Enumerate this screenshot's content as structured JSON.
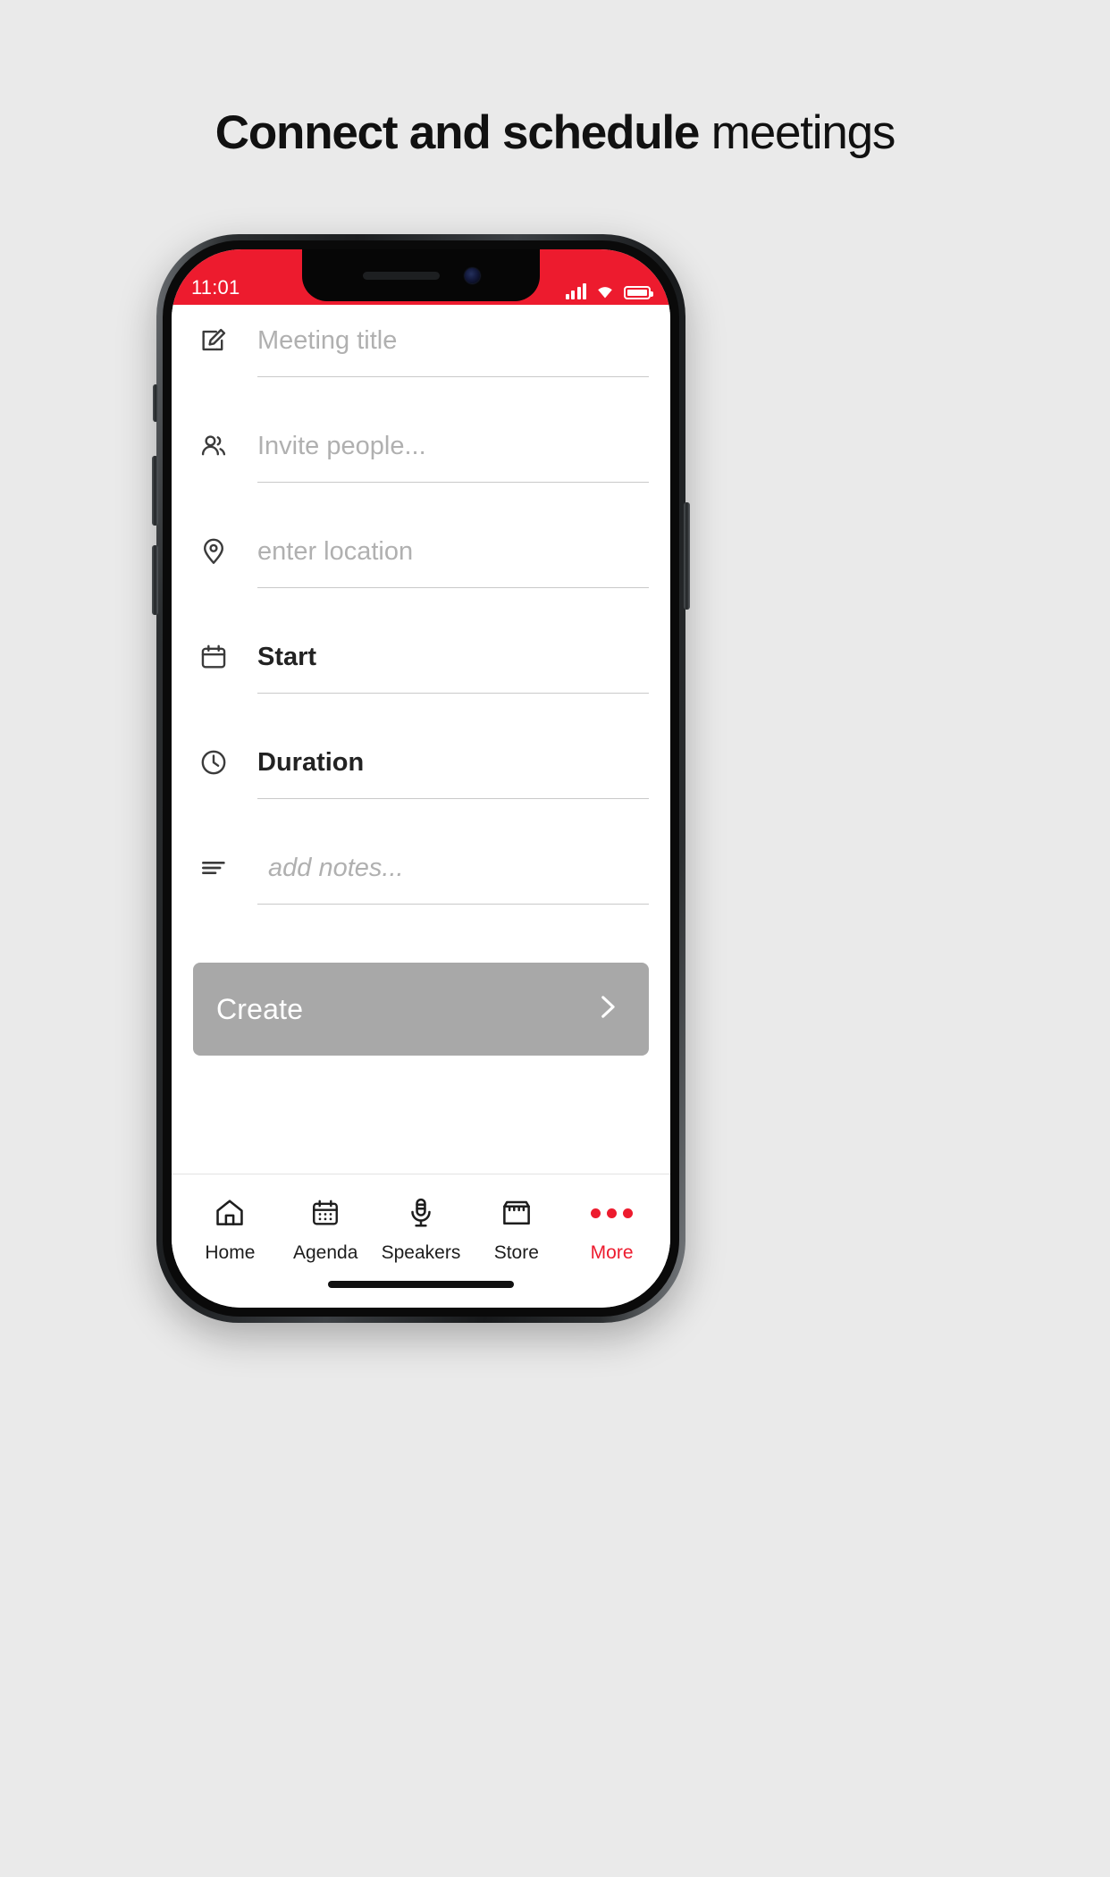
{
  "headline": {
    "bold_part": "Connect and schedule",
    "light_part": " meetings"
  },
  "colors": {
    "brand_red": "#ed1b2e",
    "page_background": "#eaeaea",
    "create_button": "#a8a8a8",
    "placeholder_text": "#b0b0b0"
  },
  "phone": {
    "status_bar": {
      "time": "11:01",
      "signal_icon": "signal-bars-icon",
      "wifi_icon": "wifi-icon",
      "battery_icon": "battery-full-icon"
    }
  },
  "form": {
    "rows": [
      {
        "icon": "edit-square-icon",
        "text": "Meeting title",
        "style": "placeholder"
      },
      {
        "icon": "people-icon",
        "text": "Invite people...",
        "style": "placeholder"
      },
      {
        "icon": "location-pin-icon",
        "text": "enter location",
        "style": "placeholder"
      },
      {
        "icon": "calendar-icon",
        "text": "Start",
        "style": "value"
      },
      {
        "icon": "clock-icon",
        "text": "Duration",
        "style": "value"
      },
      {
        "icon": "notes-lines-icon",
        "text": "add notes...",
        "style": "notes"
      }
    ],
    "create_button": {
      "label": "Create",
      "chevron_icon": "chevron-right-icon"
    }
  },
  "bottom_nav": {
    "items": [
      {
        "label": "Home",
        "icon": "home-icon",
        "active": false
      },
      {
        "label": "Agenda",
        "icon": "calendar-icon",
        "active": false
      },
      {
        "label": "Speakers",
        "icon": "microphone-icon",
        "active": false
      },
      {
        "label": "Store",
        "icon": "store-icon",
        "active": false
      },
      {
        "label": "More",
        "icon": "more-dots-icon",
        "active": true
      }
    ]
  }
}
